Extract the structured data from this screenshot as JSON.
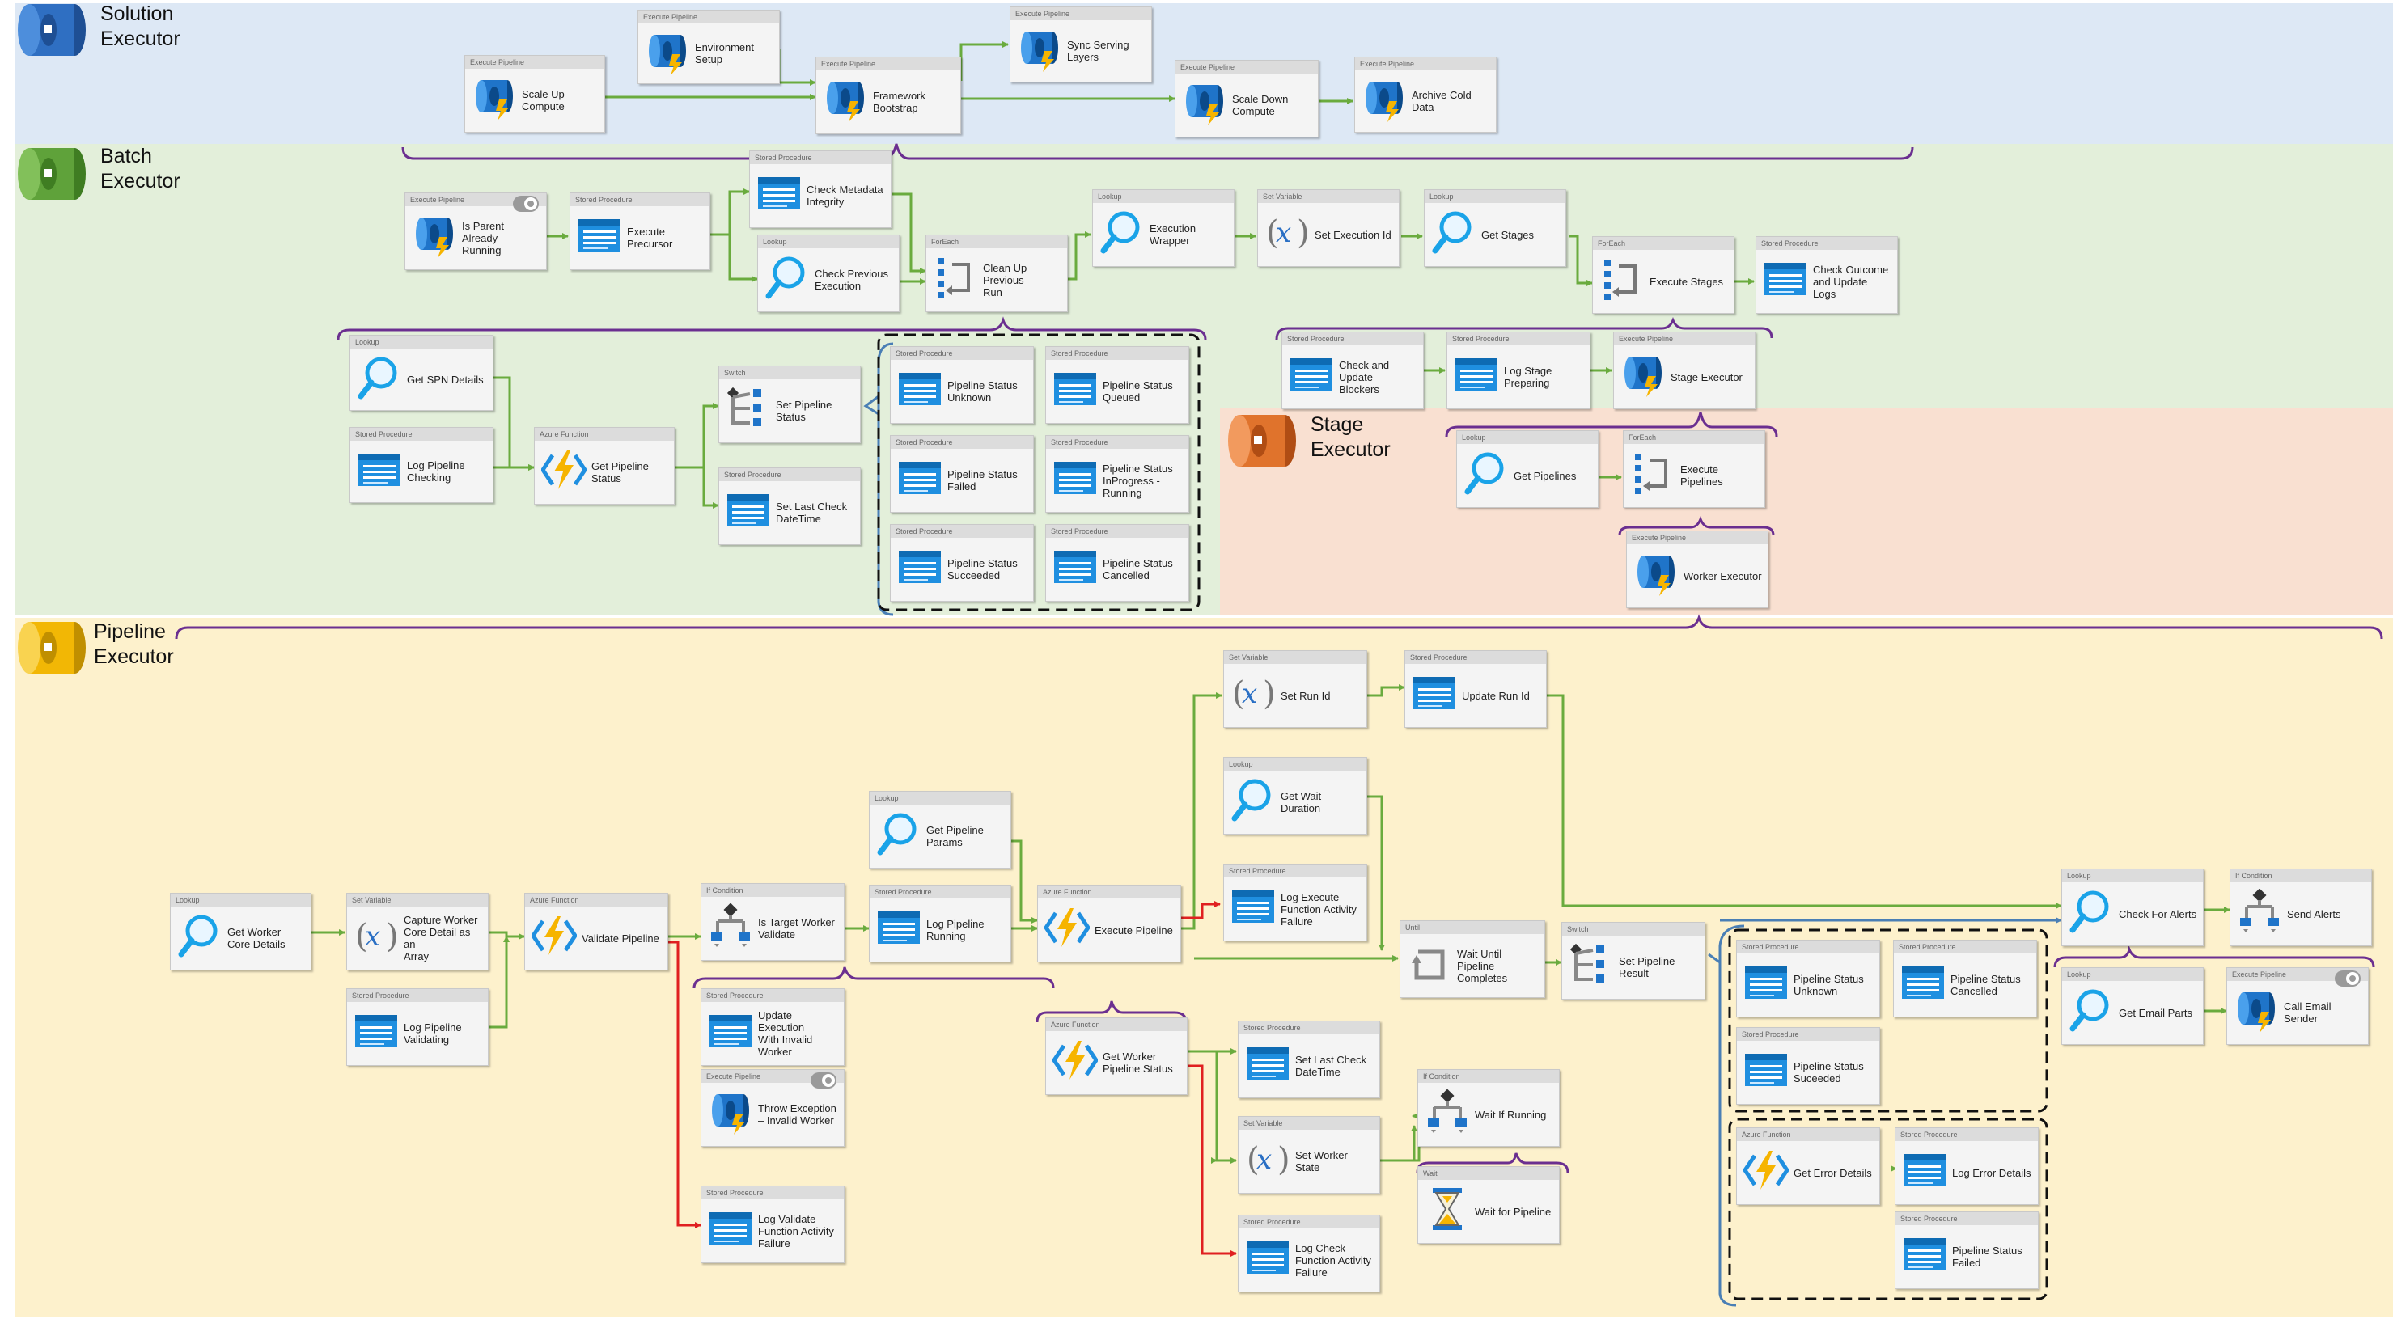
{
  "sections": {
    "solution": "Solution\nExecutor",
    "batch": "Batch\nExecutor",
    "stage": "Stage\nExecutor",
    "pipeline": "Pipeline\nExecutor"
  },
  "colors": {
    "solution_band": "#dde8f5",
    "batch_band": "#e3efda",
    "stage_band": "#f9e0d1",
    "pipeline_band": "#fdf1cc",
    "success_arrow": "#6aab3e",
    "failure_arrow": "#e02020",
    "brace": "#6b2f90",
    "loop_bracket": "#4a7fb5"
  },
  "nodes": [
    {
      "id": "scale-up-compute",
      "type": "Execute Pipeline",
      "label": "Scale Up\nCompute",
      "icon": "pipeline-icon"
    },
    {
      "id": "environment-setup",
      "type": "Execute Pipeline",
      "label": "Environment\nSetup",
      "icon": "pipeline-icon"
    },
    {
      "id": "framework-bootstrap",
      "type": "Execute Pipeline",
      "label": "Framework\nBootstrap",
      "icon": "pipeline-icon"
    },
    {
      "id": "sync-serving-layers",
      "type": "Execute Pipeline",
      "label": "Sync Serving\nLayers",
      "icon": "pipeline-icon"
    },
    {
      "id": "scale-down-compute",
      "type": "Execute Pipeline",
      "label": "Scale Down\nCompute",
      "icon": "pipeline-icon"
    },
    {
      "id": "archive-cold-data",
      "type": "Execute Pipeline",
      "label": "Archive Cold Data",
      "icon": "pipeline-icon"
    },
    {
      "id": "is-parent-already-running",
      "type": "Execute Pipeline",
      "label": "Is Parent Already\nRunning",
      "icon": "pipeline-icon",
      "extra": "toggle"
    },
    {
      "id": "execute-precursor",
      "type": "Stored Procedure",
      "label": "Execute Precursor",
      "icon": "stored-procedure-icon"
    },
    {
      "id": "check-metadata-integrity",
      "type": "Stored Procedure",
      "label": "Check Metadata\nIntegrity",
      "icon": "stored-procedure-icon"
    },
    {
      "id": "check-previous-execution",
      "type": "Lookup",
      "label": "Check Previous\nExecution",
      "icon": "lookup-icon"
    },
    {
      "id": "clean-up-previous-run",
      "type": "ForEach",
      "label": "Clean Up Previous\nRun",
      "icon": "foreach-icon"
    },
    {
      "id": "execution-wrapper",
      "type": "Lookup",
      "label": "Execution\nWrapper",
      "icon": "lookup-icon"
    },
    {
      "id": "set-execution-id",
      "type": "Set Variable",
      "label": "Set Execution Id",
      "icon": "variable-icon"
    },
    {
      "id": "get-stages",
      "type": "Lookup",
      "label": "Get Stages",
      "icon": "lookup-icon"
    },
    {
      "id": "execute-stages",
      "type": "ForEach",
      "label": "Execute Stages",
      "icon": "foreach-icon"
    },
    {
      "id": "check-outcome-update-logs",
      "type": "Stored Procedure",
      "label": "Check Outcome\nand Update Logs",
      "icon": "stored-procedure-icon"
    },
    {
      "id": "get-spn-details",
      "type": "Lookup",
      "label": "Get SPN Details",
      "icon": "lookup-icon"
    },
    {
      "id": "log-pipeline-checking",
      "type": "Stored Procedure",
      "label": "Log Pipeline\nChecking",
      "icon": "stored-procedure-icon"
    },
    {
      "id": "get-pipeline-status",
      "type": "Azure Function",
      "label": "Get Pipeline\nStatus",
      "icon": "function-icon"
    },
    {
      "id": "set-pipeline-status",
      "type": "Switch",
      "label": "Set Pipeline\nStatus",
      "icon": "switch-icon"
    },
    {
      "id": "set-last-check-datetime-1",
      "type": "Stored Procedure",
      "label": "Set Last Check\nDateTime",
      "icon": "stored-procedure-icon"
    },
    {
      "id": "ps-unknown-1",
      "type": "Stored Procedure",
      "label": "Pipeline Status\nUnknown",
      "icon": "stored-procedure-icon"
    },
    {
      "id": "ps-queued",
      "type": "Stored Procedure",
      "label": "Pipeline Status\nQueued",
      "icon": "stored-procedure-icon"
    },
    {
      "id": "ps-failed-1",
      "type": "Stored Procedure",
      "label": "Pipeline Status\nFailed",
      "icon": "stored-procedure-icon"
    },
    {
      "id": "ps-inprogress",
      "type": "Stored Procedure",
      "label": "Pipeline Status\nInProgress -\nRunning",
      "icon": "stored-procedure-icon"
    },
    {
      "id": "ps-succeeded-1",
      "type": "Stored Procedure",
      "label": "Pipeline Status\nSucceeded",
      "icon": "stored-procedure-icon"
    },
    {
      "id": "ps-cancelled-1",
      "type": "Stored Procedure",
      "label": "Pipeline Status\nCancelled",
      "icon": "stored-procedure-icon"
    },
    {
      "id": "check-update-blockers",
      "type": "Stored Procedure",
      "label": "Check and Update\nBlockers",
      "icon": "stored-procedure-icon"
    },
    {
      "id": "log-stage-preparing",
      "type": "Stored Procedure",
      "label": "Log Stage\nPreparing",
      "icon": "stored-procedure-icon"
    },
    {
      "id": "stage-executor",
      "type": "Execute Pipeline",
      "label": "Stage Executor",
      "icon": "pipeline-icon"
    },
    {
      "id": "get-pipelines",
      "type": "Lookup",
      "label": "Get Pipelines",
      "icon": "lookup-icon"
    },
    {
      "id": "execute-pipelines",
      "type": "ForEach",
      "label": "Execute Pipelines",
      "icon": "foreach-icon"
    },
    {
      "id": "worker-executor",
      "type": "Execute Pipeline",
      "label": "Worker Executor",
      "icon": "pipeline-icon"
    },
    {
      "id": "get-worker-core-details",
      "type": "Lookup",
      "label": "Get Worker\nCore Details",
      "icon": "lookup-icon"
    },
    {
      "id": "capture-worker-core-detail",
      "type": "Set Variable",
      "label": "Capture Worker\nCore Detail as an\nArray",
      "icon": "variable-icon"
    },
    {
      "id": "log-pipeline-validating",
      "type": "Stored Procedure",
      "label": "Log Pipeline\nValidating",
      "icon": "stored-procedure-icon"
    },
    {
      "id": "validate-pipeline",
      "type": "Azure Function",
      "label": "Validate Pipeline",
      "icon": "function-icon"
    },
    {
      "id": "is-target-worker-validate",
      "type": "If Condition",
      "label": "Is Target Worker\nValidate",
      "icon": "if-icon"
    },
    {
      "id": "update-execution-invalid-worker",
      "type": "Stored Procedure",
      "label": "Update Execution\nWith Invalid\nWorker",
      "icon": "stored-procedure-icon"
    },
    {
      "id": "throw-exception-invalid-worker",
      "type": "Execute Pipeline",
      "label": "Throw Exception\n– Invalid Worker",
      "icon": "pipeline-icon",
      "extra": "toggle"
    },
    {
      "id": "log-validate-function-failure",
      "type": "Stored Procedure",
      "label": "Log Validate\nFunction Activity\nFailure",
      "icon": "stored-procedure-icon"
    },
    {
      "id": "get-pipeline-params",
      "type": "Lookup",
      "label": "Get Pipeline\nParams",
      "icon": "lookup-icon"
    },
    {
      "id": "log-pipeline-running",
      "type": "Stored Procedure",
      "label": "Log Pipeline\nRunning",
      "icon": "stored-procedure-icon"
    },
    {
      "id": "execute-pipeline",
      "type": "Azure Function",
      "label": "Execute Pipeline",
      "icon": "function-icon"
    },
    {
      "id": "set-run-id",
      "type": "Set Variable",
      "label": "Set Run Id",
      "icon": "variable-icon"
    },
    {
      "id": "update-run-id",
      "type": "Stored Procedure",
      "label": "Update Run Id",
      "icon": "stored-procedure-icon"
    },
    {
      "id": "get-wait-duration",
      "type": "Lookup",
      "label": "Get Wait\nDuration",
      "icon": "lookup-icon"
    },
    {
      "id": "log-execute-function-failure",
      "type": "Stored Procedure",
      "label": "Log Execute\nFunction Activity\nFailure",
      "icon": "stored-procedure-icon"
    },
    {
      "id": "wait-until-pipeline-completes",
      "type": "Until",
      "label": "Wait Until\nPipeline\nCompletes",
      "icon": "until-icon"
    },
    {
      "id": "get-worker-pipeline-status",
      "type": "Azure Function",
      "label": "Get Worker\nPipeline Status",
      "icon": "function-icon"
    },
    {
      "id": "set-last-check-datetime-2",
      "type": "Stored Procedure",
      "label": "Set Last Check\nDateTime",
      "icon": "stored-procedure-icon"
    },
    {
      "id": "set-worker-state",
      "type": "Set Variable",
      "label": "Set Worker State",
      "icon": "variable-icon"
    },
    {
      "id": "log-check-function-failure",
      "type": "Stored Procedure",
      "label": "Log Check\nFunction Activity\nFailure",
      "icon": "stored-procedure-icon"
    },
    {
      "id": "wait-if-running",
      "type": "If Condition",
      "label": "Wait If Running",
      "icon": "if-icon"
    },
    {
      "id": "wait-for-pipeline",
      "type": "Wait",
      "label": "Wait for Pipeline",
      "icon": "hourglass-icon"
    },
    {
      "id": "set-pipeline-result",
      "type": "Switch",
      "label": "Set Pipeline\nResult",
      "icon": "switch-icon"
    },
    {
      "id": "ps-unknown-2",
      "type": "Stored Procedure",
      "label": "Pipeline Status\nUnknown",
      "icon": "stored-procedure-icon"
    },
    {
      "id": "ps-cancelled-2",
      "type": "Stored Procedure",
      "label": "Pipeline Status\nCancelled",
      "icon": "stored-procedure-icon"
    },
    {
      "id": "ps-succeeded-2",
      "type": "Stored Procedure",
      "label": "Pipeline Status\nSuceeded",
      "icon": "stored-procedure-icon"
    },
    {
      "id": "get-error-details",
      "type": "Azure Function",
      "label": "Get Error Details",
      "icon": "function-icon"
    },
    {
      "id": "log-error-details",
      "type": "Stored Procedure",
      "label": "Log Error Details",
      "icon": "stored-procedure-icon"
    },
    {
      "id": "ps-failed-2",
      "type": "Stored Procedure",
      "label": "Pipeline Status\nFailed",
      "icon": "stored-procedure-icon"
    },
    {
      "id": "check-for-alerts",
      "type": "Lookup",
      "label": "Check For Alerts",
      "icon": "lookup-icon"
    },
    {
      "id": "send-alerts",
      "type": "If Condition",
      "label": "Send Alerts",
      "icon": "if-icon"
    },
    {
      "id": "get-email-parts",
      "type": "Lookup",
      "label": "Get Email Parts",
      "icon": "lookup-icon"
    },
    {
      "id": "call-email-sender",
      "type": "Execute Pipeline",
      "label": "Call Email Sender",
      "icon": "pipeline-icon",
      "extra": "toggle"
    }
  ]
}
